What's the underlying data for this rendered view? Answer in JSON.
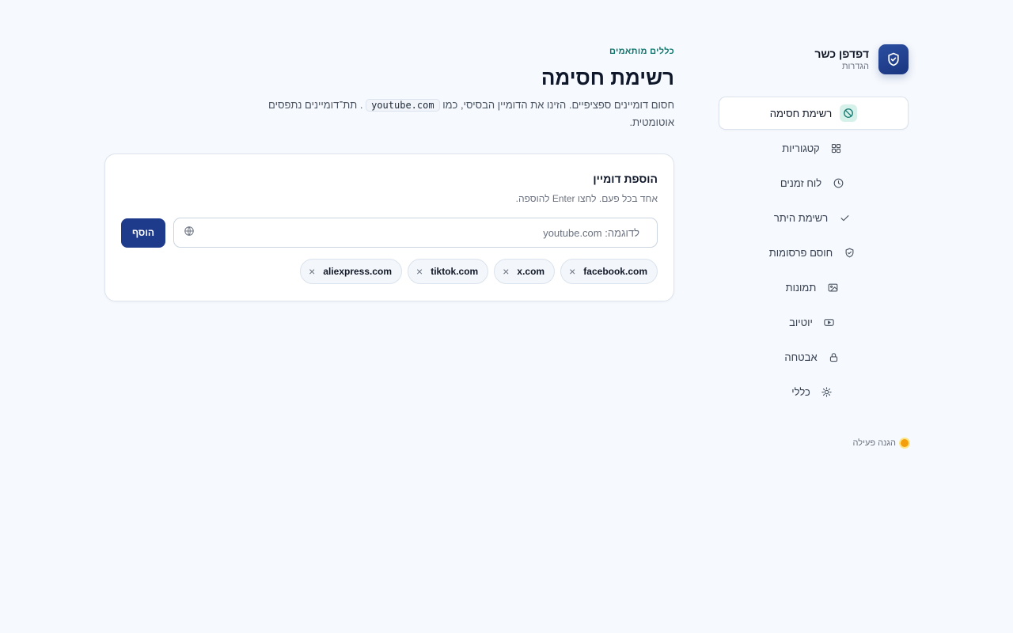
{
  "brand": {
    "name": "דפדפן כשר",
    "subtitle": "הגדרות"
  },
  "nav": {
    "items": [
      {
        "label": "רשימת חסימה",
        "icon": "block-icon",
        "active": true
      },
      {
        "label": "קטגוריות",
        "icon": "grid-icon",
        "active": false
      },
      {
        "label": "לוח זמנים",
        "icon": "clock-icon",
        "active": false
      },
      {
        "label": "רשימת היתר",
        "icon": "check-icon",
        "active": false
      },
      {
        "label": "חוסם פרסומות",
        "icon": "shield-icon",
        "active": false
      },
      {
        "label": "תמונות",
        "icon": "image-icon",
        "active": false
      },
      {
        "label": "יוטיוב",
        "icon": "youtube-icon",
        "active": false
      },
      {
        "label": "אבטחה",
        "icon": "lock-icon",
        "active": false
      },
      {
        "label": "כללי",
        "icon": "sun-icon",
        "active": false
      }
    ]
  },
  "status": {
    "label": "הגנה פעילה",
    "color": "#f59e0b"
  },
  "main": {
    "eyebrow": "כללים מותאמים",
    "title": "רשימת חסימה",
    "description_before": "חסום דומיינים ספציפיים. הזינו את הדומיין הבסיסי, כמו",
    "description_code": "youtube.com",
    "description_after": ". תת־דומיינים נתפסים אוטומטית."
  },
  "card": {
    "title": "הוספת דומיין",
    "subtitle": "אחד בכל פעם. לחצו Enter להוספה.",
    "input_placeholder": "לדוגמה: youtube.com",
    "input_value": "",
    "add_label": "הוסף"
  },
  "domains": [
    "facebook.com",
    "x.com",
    "tiktok.com",
    "aliexpress.com"
  ],
  "chip_remove_glyph": "×",
  "colors": {
    "accent": "#1e3a8a",
    "eyebrow": "#0f766e",
    "background": "#f6f9fd"
  }
}
